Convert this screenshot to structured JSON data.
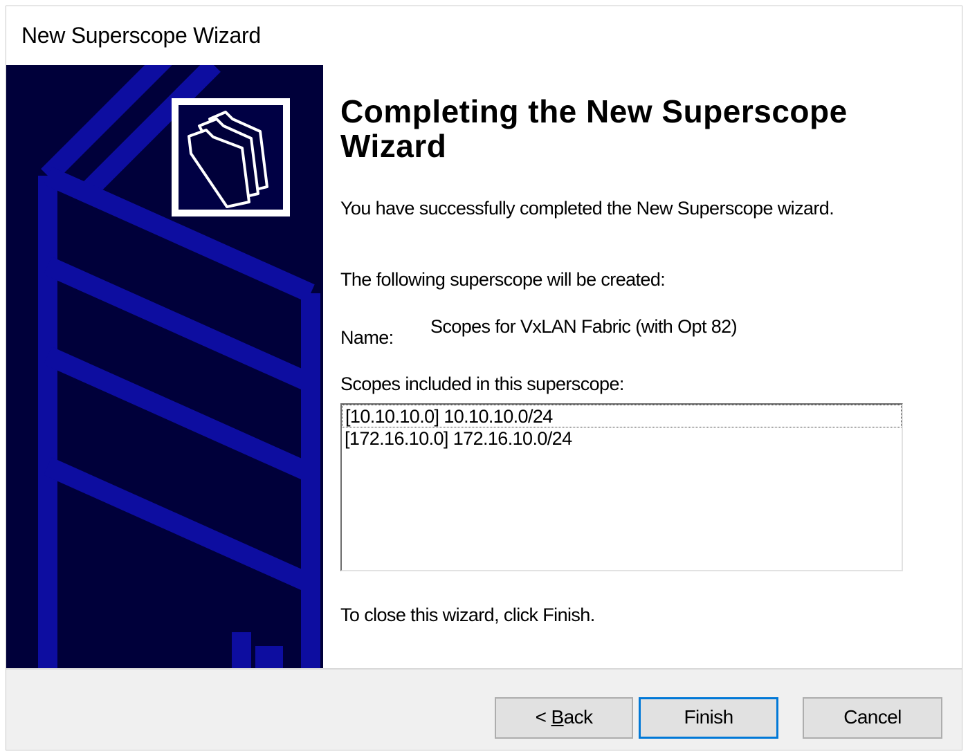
{
  "window": {
    "title": "New Superscope Wizard"
  },
  "banner": {
    "icon": "folders-icon",
    "background_color": "#00003a",
    "accent_color": "#0d0da0"
  },
  "content": {
    "heading": "Completing the New Superscope Wizard",
    "success_text": "You have successfully completed the New Superscope wizard.",
    "following_text": "The following superscope will be created:",
    "name_label": "Name:",
    "name_value": "Scopes for VxLAN Fabric (with Opt 82)",
    "scopes_label": "Scopes included in this superscope:",
    "scopes": [
      "[10.10.10.0] 10.10.10.0/24",
      "[172.16.10.0] 172.16.10.0/24"
    ],
    "close_text": "To close this wizard, click Finish."
  },
  "buttons": {
    "back_prefix": "< ",
    "back_accel": "B",
    "back_rest": "ack",
    "finish": "Finish",
    "cancel": "Cancel",
    "default_color": "#0078d7"
  }
}
